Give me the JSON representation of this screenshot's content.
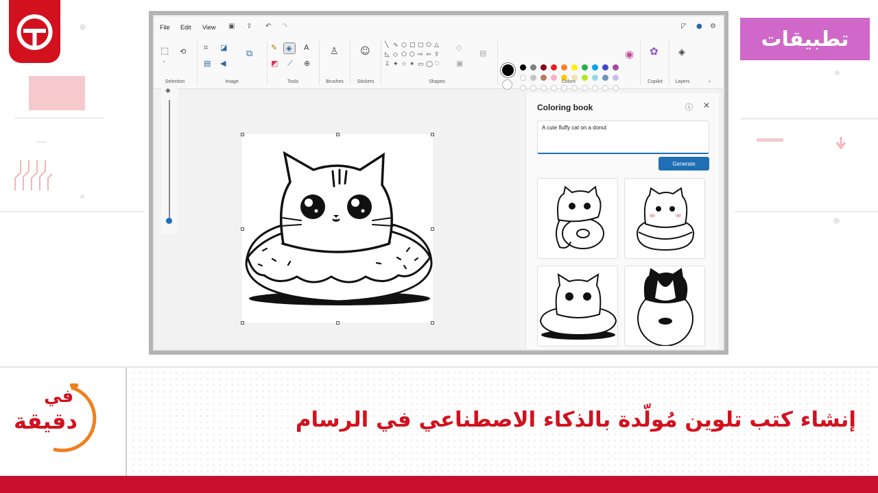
{
  "badge": {
    "label": "تطبيقات"
  },
  "headline": {
    "text": "إنشاء كتب تلوين مُولّدة بالذكاء الاصطناعي في الرسام"
  },
  "show_logo": {
    "line1": "في",
    "line2": "دقيقة"
  },
  "colors": {
    "brand_red": "#d3111e",
    "badge_purple": "#cf68c8",
    "accent_blue": "#1f6fb5"
  },
  "paint": {
    "menu": [
      "File",
      "Edit",
      "View"
    ],
    "menu_icons": [
      "save-icon",
      "share-icon",
      "undo-icon",
      "redo-icon"
    ],
    "groups": [
      "Selection",
      "Image",
      "Tools",
      "Brushes",
      "Stickers",
      "Shapes",
      "Colors",
      "Copilot",
      "Layers"
    ],
    "palette": [
      "#000000",
      "#7f7f7f",
      "#880015",
      "#ed1c24",
      "#ff7f27",
      "#fff200",
      "#22b14c",
      "#00a2e8",
      "#3f48cc",
      "#a349a4",
      "#ffffff",
      "#c3c3c3",
      "#b97a57",
      "#ffaec9",
      "#ffc90e",
      "#efe4b0",
      "#b5e61d",
      "#99d9ea",
      "#7092be",
      "#c8bfe7"
    ],
    "coloring_panel": {
      "title": "Coloring book",
      "prompt": "A cute fluffy cat on a donut",
      "generate_label": "Generate"
    }
  }
}
